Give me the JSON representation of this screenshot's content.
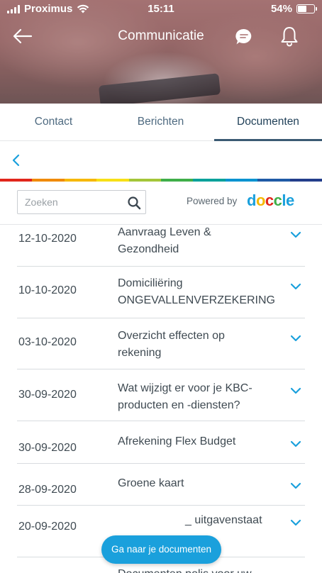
{
  "status_bar": {
    "carrier": "Proximus",
    "time": "15:11",
    "battery": "54%"
  },
  "nav": {
    "title": "Communicatie"
  },
  "tabs": [
    {
      "label": "Contact",
      "active": false
    },
    {
      "label": "Berichten",
      "active": false
    },
    {
      "label": "Documenten",
      "active": true
    }
  ],
  "rainbow_colors": [
    "#e1261c",
    "#f08a00",
    "#f6b800",
    "#f7e017",
    "#a4c639",
    "#3fae49",
    "#00a19a",
    "#0093d0",
    "#1f5aa6",
    "#233e8b"
  ],
  "search": {
    "placeholder": "Zoeken"
  },
  "powered_by": {
    "label": "Powered by",
    "logo_letters": [
      "d",
      "o",
      "c",
      "c",
      "l",
      "e"
    ],
    "logo_colors": [
      "#1aa0dc",
      "#f6b800",
      "#e1261c",
      "#3fae49",
      "#1aa0dc",
      "#1aa0dc"
    ]
  },
  "documents": [
    {
      "date": "12-10-2020",
      "title_lines": [
        "Aanvraag Leven &",
        "Gezondheid"
      ]
    },
    {
      "date": "10-10-2020",
      "title_lines": [
        "Domiciliëring",
        "ONGEVALLENVERZEKERING"
      ]
    },
    {
      "date": "03-10-2020",
      "title_lines": [
        "Overzicht effecten op",
        "rekening"
      ]
    },
    {
      "date": "30-09-2020",
      "title_lines": [
        "Wat wijzigt er voor je KBC-",
        "producten en -diensten?"
      ]
    },
    {
      "date": "30-09-2020",
      "title_lines": [
        "Afrekening Flex Budget"
      ]
    },
    {
      "date": "28-09-2020",
      "title_lines": [
        "Groene kaart"
      ]
    },
    {
      "date": "20-09-2020",
      "title_lines": [
        "_ uitgavenstaat"
      ]
    },
    {
      "date": "",
      "title_lines": [
        "Documenten polis voor uw"
      ]
    }
  ],
  "fab": {
    "label": "Ga naar je documenten"
  },
  "colors": {
    "accent": "#1aa0dc",
    "tab_indicator": "#3b5a73"
  }
}
